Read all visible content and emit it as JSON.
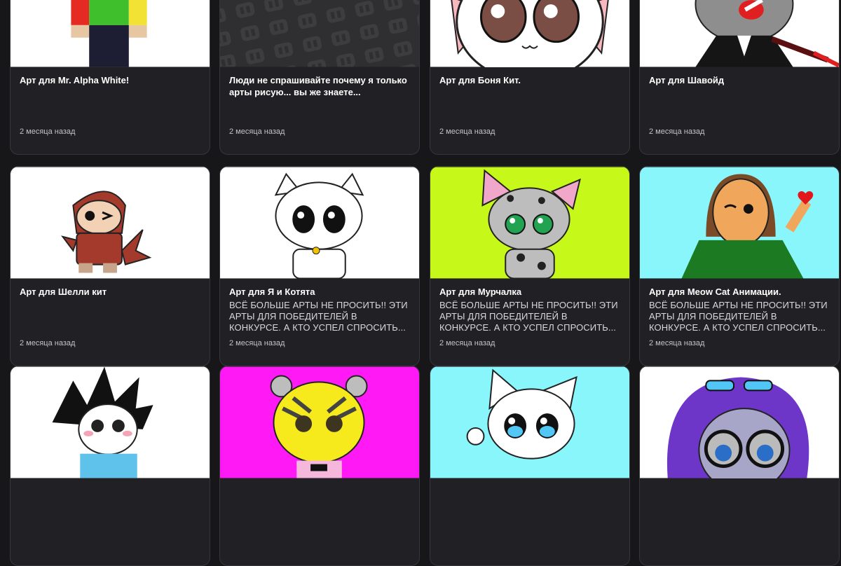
{
  "cards": [
    {
      "title": "Арт для Mr. Alpha White!",
      "description": "",
      "date": "2 месяца назад",
      "bg": "#ffffff"
    },
    {
      "title": "Люди не спрашивайте почему я только арты рисую... вы же знаете...",
      "description": "",
      "date": "2 месяца назад",
      "bg": "#2f2f31"
    },
    {
      "title": "Арт для Боня Кит.",
      "description": "",
      "date": "2 месяца назад",
      "bg": "#ffffff"
    },
    {
      "title": "Арт для Шавойд",
      "description": "",
      "date": "2 месяца назад",
      "bg": "#ffffff"
    },
    {
      "title": "Арт для Шелли кит",
      "description": "",
      "date": "2 месяца назад",
      "bg": "#ffffff"
    },
    {
      "title": "Арт для Я и Котята",
      "description": "ВСЁ БОЛЬШЕ АРТЫ НЕ ПРОСИТЬ!! ЭТИ АРТЫ ДЛЯ ПОБЕДИТЕЛЕЙ В КОНКУРСЕ. А КТО УСПЕЛ СПРОСИТЬ...",
      "date": "2 месяца назад",
      "bg": "#ffffff"
    },
    {
      "title": "Арт для Мурчалка",
      "description": "ВСЁ БОЛЬШЕ АРТЫ НЕ ПРОСИТЬ!! ЭТИ АРТЫ ДЛЯ ПОБЕДИТЕЛЕЙ В КОНКУРСЕ. А КТО УСПЕЛ СПРОСИТЬ...",
      "date": "2 месяца назад",
      "bg": "#c6f91a"
    },
    {
      "title": "Арт для Meow Cat Анимации.",
      "description": "ВСЁ БОЛЬШЕ АРТЫ НЕ ПРОСИТЬ!! ЭТИ АРТЫ ДЛЯ ПОБЕДИТЕЛЕЙ В КОНКУРСЕ. А КТО УСПЕЛ СПРОСИТЬ...",
      "date": "2 месяца назад",
      "bg": "#88f6fb"
    },
    {
      "title": "",
      "description": "",
      "date": "",
      "bg": "#ffffff"
    },
    {
      "title": "",
      "description": "",
      "date": "",
      "bg": "#ff19f5"
    },
    {
      "title": "",
      "description": "",
      "date": "",
      "bg": "#88f6fb"
    },
    {
      "title": "",
      "description": "",
      "date": "",
      "bg": "#ffffff"
    }
  ]
}
